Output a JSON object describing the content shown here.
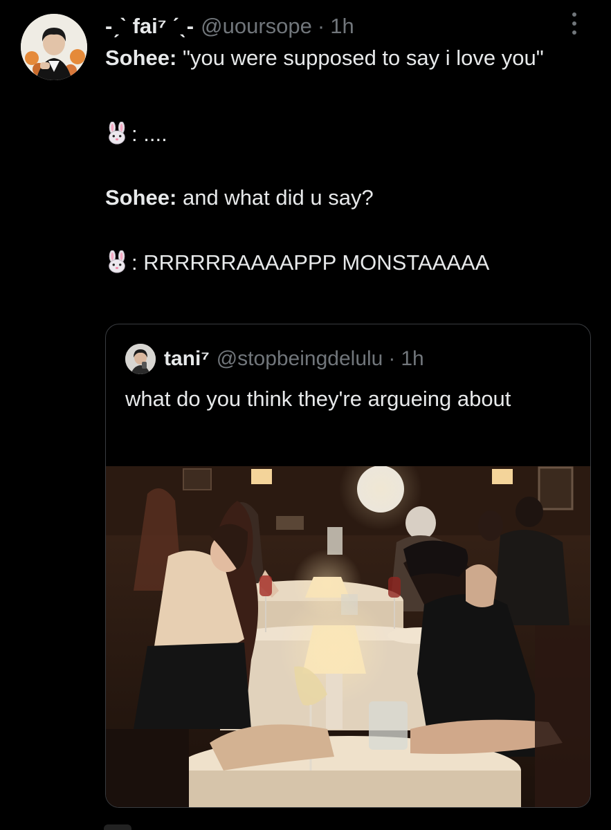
{
  "tweet": {
    "display_name": "-ˏˋ fai⁷ ˊˎ-",
    "handle": "@uoursope",
    "separator": "·",
    "time": "1h",
    "lines": [
      {
        "speaker": "Sohee:",
        "text": " \"you were supposed to say i love you\""
      },
      {
        "speaker": "",
        "text": ": ...."
      },
      {
        "speaker": "Sohee:",
        "text": " and what did u say?"
      },
      {
        "speaker": "",
        "text": ": RRRRRRAAAAPPP MONSTAAAAA"
      }
    ]
  },
  "quote": {
    "display_name": "tani⁷",
    "handle": "@stopbeingdelulu",
    "separator": "·",
    "time": "1h",
    "text": "what do you think they're argueing about"
  },
  "icons": {
    "more": "more-vertical-icon",
    "bunny": "rabbit-face-emoji"
  },
  "colors": {
    "background": "#000000",
    "text": "#e7e9ea",
    "muted": "#71767b",
    "border": "#3a3d41"
  }
}
